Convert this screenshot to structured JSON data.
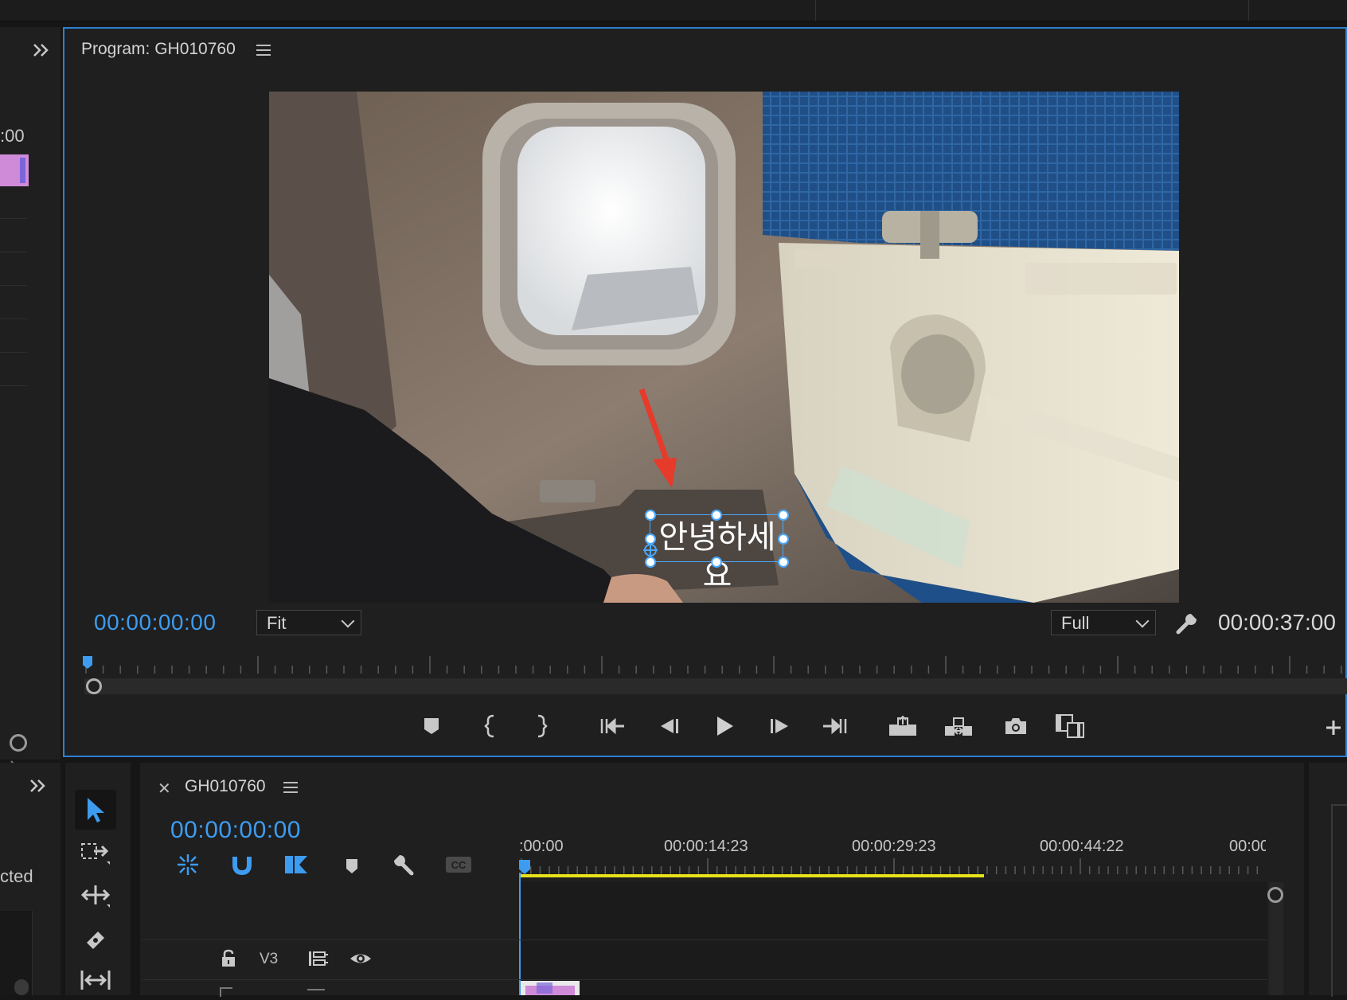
{
  "program_monitor": {
    "title": "Program: GH010760",
    "current_timecode": "00:00:00:00",
    "duration_timecode": "00:00:37:00",
    "zoom_select": {
      "selected": "Fit"
    },
    "quality_select": {
      "selected": "Full"
    },
    "overlay_text": "안녕하세요",
    "left_panel_timecode": ":00"
  },
  "timeline": {
    "sequence_name": "GH010760",
    "current_timecode": "00:00:00:00",
    "ruler_labels": [
      ":00:00",
      "00:00:14:23",
      "00:00:29:23",
      "00:00:44:22",
      "00:00:"
    ],
    "tracks": [
      {
        "label": "V3"
      }
    ]
  },
  "left_panel": {
    "partial_label": "cted"
  },
  "colors": {
    "accent_blue": "#3d9cf0",
    "work_area": "#e8e21a",
    "clip_pink": "#cf8ad8"
  }
}
